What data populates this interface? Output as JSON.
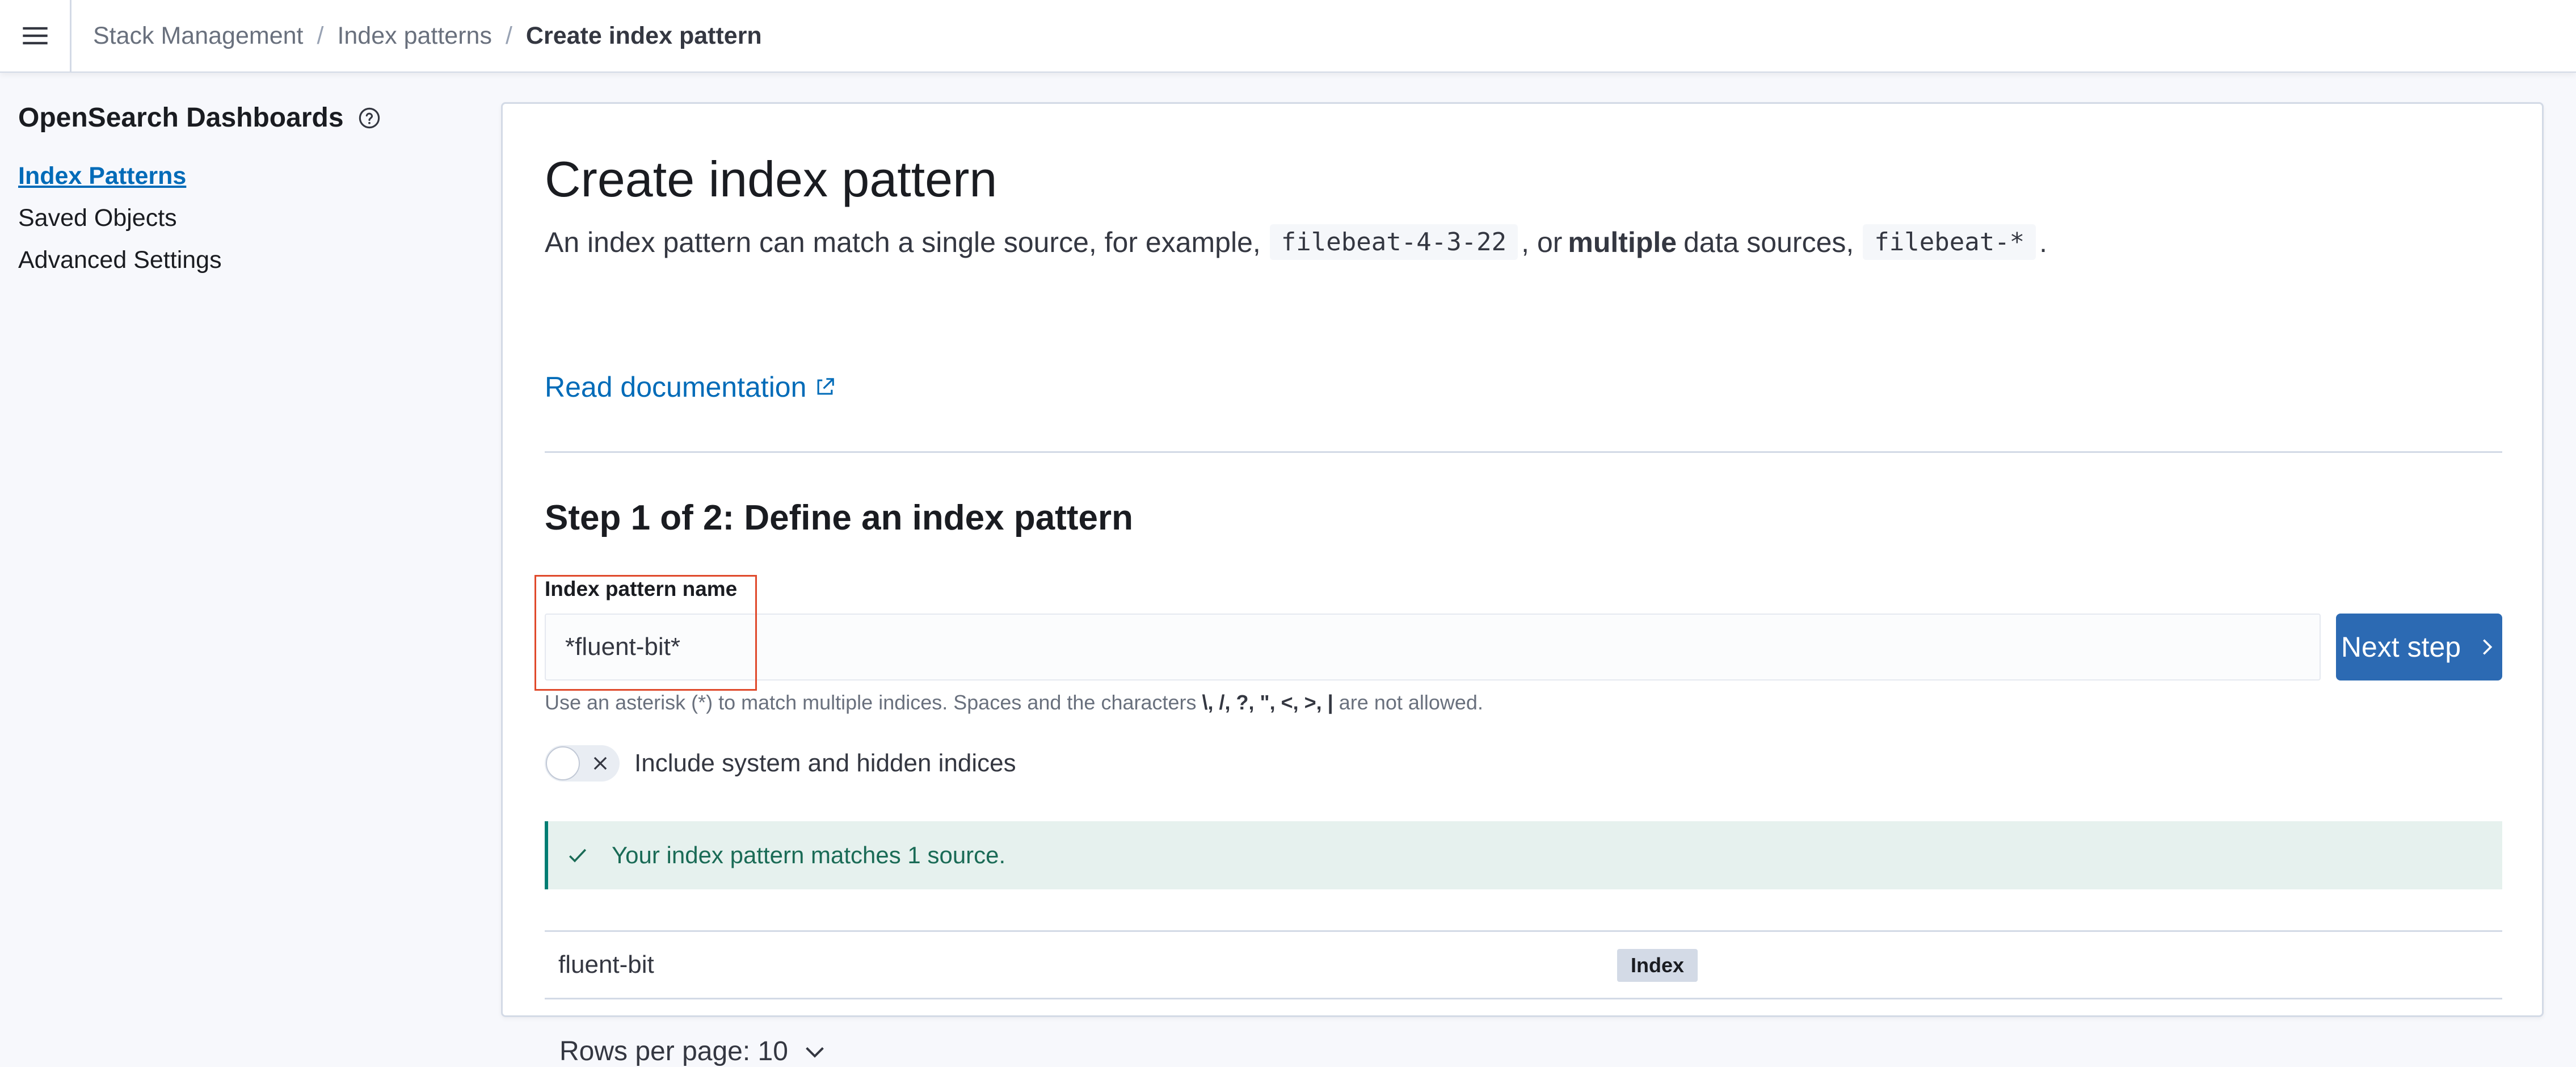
{
  "header": {
    "breadcrumbs": [
      {
        "label": "Stack Management"
      },
      {
        "label": "Index patterns"
      },
      {
        "label": "Create index pattern"
      }
    ],
    "separator": "/"
  },
  "sidebar": {
    "title": "OpenSearch Dashboards",
    "items": [
      {
        "label": "Index Patterns",
        "active": true
      },
      {
        "label": "Saved Objects",
        "active": false
      },
      {
        "label": "Advanced Settings",
        "active": false
      }
    ]
  },
  "main": {
    "title": "Create index pattern",
    "description": {
      "part1": "An index pattern can match a single source, for example,",
      "code1": "filebeat-4-3-22",
      "part2": ", or",
      "bold": "multiple",
      "part3": "data sources,",
      "code2": "filebeat-*",
      "part4": "."
    },
    "doc_link": "Read documentation",
    "step_title": "Step 1 of 2: Define an index pattern",
    "field_label": "Index pattern name",
    "input_value": "*fluent-bit*",
    "next_button": "Next step",
    "help": {
      "prefix": "Use an asterisk (*) to match multiple indices. Spaces and the characters",
      "chars": "\\, /, ?, \", <, >, |",
      "suffix": "are not allowed."
    },
    "toggle_label": "Include system and hidden indices",
    "toggle_on": false,
    "callout": "Your index pattern matches 1 source.",
    "table": {
      "rows": [
        {
          "name": "fluent-bit",
          "badge": "Index"
        }
      ]
    },
    "pagination": "Rows per page: 10"
  },
  "colors": {
    "accent": "#006bb8",
    "primary_button": "#2c6ab3",
    "success_bg": "#e6f1ee",
    "success_text": "#1a6b56",
    "highlight_border": "#e04a2c"
  },
  "icons": {
    "menu": "hamburger-menu-icon",
    "help": "question-circle-icon",
    "external": "external-link-icon",
    "next": "chevron-right-icon",
    "toggle_off": "cross-icon",
    "success": "check-icon",
    "pagination": "chevron-down-icon"
  }
}
